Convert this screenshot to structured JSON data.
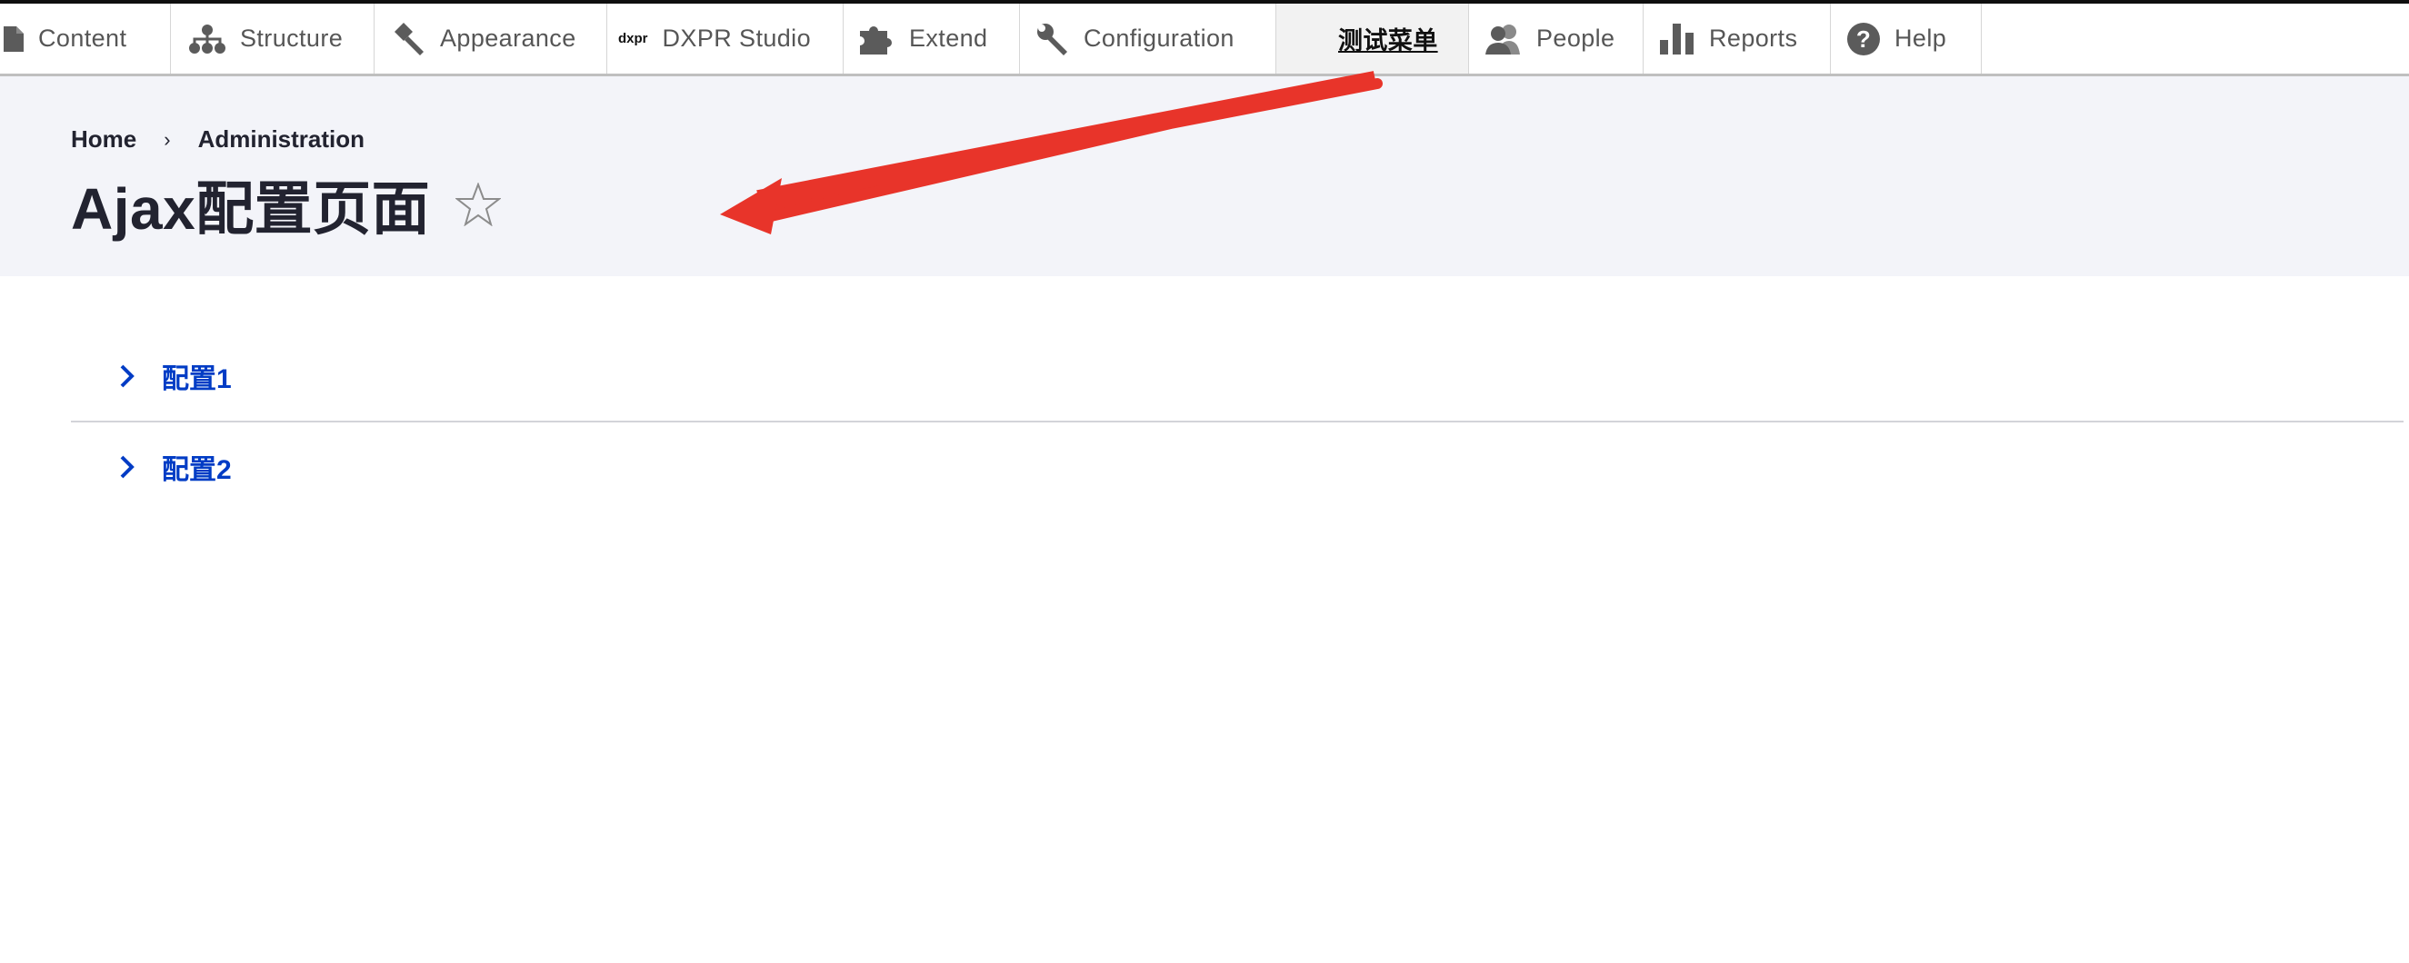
{
  "toolbar": {
    "items": [
      {
        "label": "Content",
        "icon": "content-icon"
      },
      {
        "label": "Structure",
        "icon": "structure-icon"
      },
      {
        "label": "Appearance",
        "icon": "appearance-icon"
      },
      {
        "label": "DXPR Studio",
        "icon": "dxpr-logo-icon",
        "logo_text": "dxpr"
      },
      {
        "label": "Extend",
        "icon": "puzzle-icon"
      },
      {
        "label": "Configuration",
        "icon": "wrench-icon"
      },
      {
        "label": "测试菜单",
        "active": true
      },
      {
        "label": "People",
        "icon": "people-icon"
      },
      {
        "label": "Reports",
        "icon": "reports-icon"
      },
      {
        "label": "Help",
        "icon": "help-icon"
      }
    ]
  },
  "breadcrumb": {
    "items": [
      "Home",
      "Administration"
    ],
    "separator": "›"
  },
  "page": {
    "title": "Ajax配置页面"
  },
  "details": {
    "items": [
      {
        "label": "配置1"
      },
      {
        "label": "配置2"
      }
    ]
  },
  "colors": {
    "link": "#003cc5",
    "header_bg": "#f3f4f9",
    "annotation_arrow": "#e8342a"
  }
}
